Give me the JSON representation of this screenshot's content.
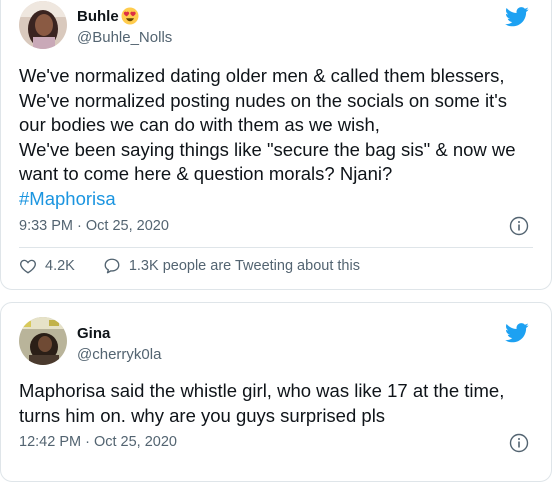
{
  "tweets": [
    {
      "name": "Buhle",
      "handle": "@Buhle_Nolls",
      "lines": [
        "We've normalized dating older men & called them blessers,",
        "We've normalized posting nudes on the socials on some it's",
        "our bodies we can do with them as we wish,",
        "We've been saying things like \"secure the bag sis\" & now we",
        "want to come here & question morals? Njani?"
      ],
      "hashtag": "#Maphorisa",
      "timestamp": "9:33 PM · Oct 25, 2020",
      "likes": "4.2K",
      "people_tweeting": "1.3K people are Tweeting about this"
    },
    {
      "name": "Gina",
      "handle": "@cherryk0la",
      "lines": [
        "Maphorisa said the whistle girl, who was like 17 at the time,",
        "turns him on. why are you guys surprised pls"
      ],
      "timestamp": "12:42 PM · Oct 25, 2020"
    }
  ],
  "colors": {
    "link": "#1b95e0",
    "twitter_blue": "#1da1f2",
    "secondary_text": "#536471",
    "border": "#dfe5e9"
  },
  "icons": {
    "brand": "twitter-bird-icon",
    "info": "info-icon",
    "like": "heart-icon",
    "reply": "speech-bubble-icon",
    "emoji": "heart-eyes-emoji-icon"
  }
}
